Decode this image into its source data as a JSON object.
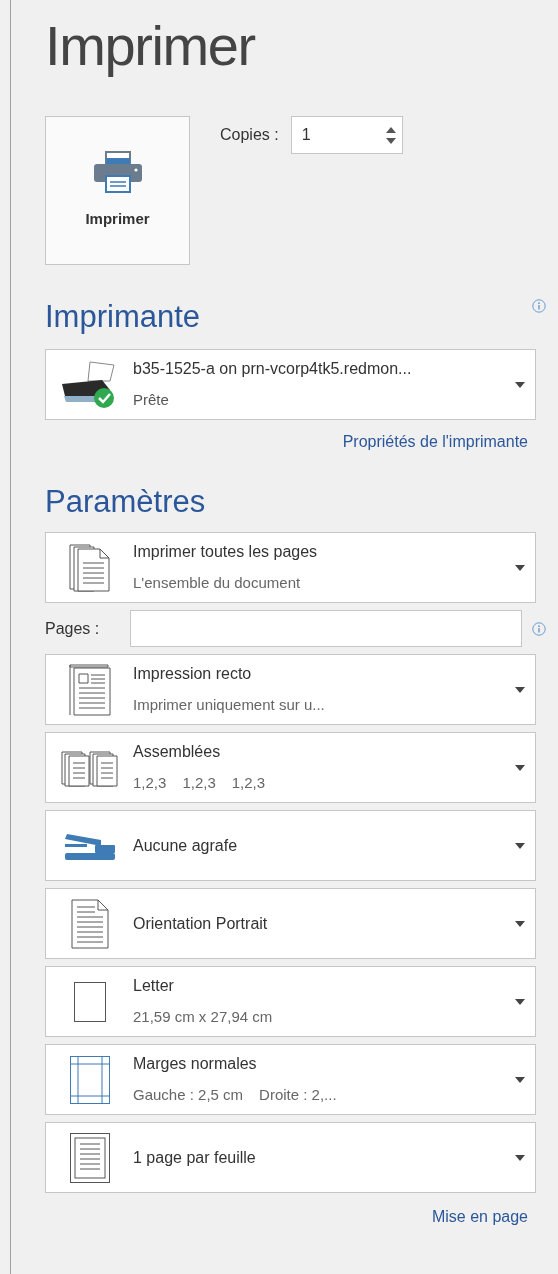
{
  "title": "Imprimer",
  "print_button": {
    "label": "Imprimer"
  },
  "copies": {
    "label": "Copies :",
    "value": "1"
  },
  "printer": {
    "heading": "Imprimante",
    "name": "b35-1525-a on prn-vcorp4tk5.redmon...",
    "status": "Prête",
    "properties_link": "Propriétés de l'imprimante"
  },
  "settings": {
    "heading": "Paramètres",
    "items": [
      {
        "kind": "pages_range",
        "title": "Imprimer toutes les pages",
        "detail": [
          "L'ensemble du document"
        ]
      },
      {
        "kind": "pages",
        "label": "Pages :"
      },
      {
        "kind": "sides",
        "title": "Impression recto",
        "detail": [
          "Imprimer uniquement sur u..."
        ]
      },
      {
        "kind": "collate",
        "title": "Assemblées",
        "detail": [
          "1,2,3",
          "1,2,3",
          "1,2,3"
        ]
      },
      {
        "kind": "staple",
        "title": "Aucune agrafe"
      },
      {
        "kind": "orientation",
        "title": "Orientation Portrait"
      },
      {
        "kind": "paper",
        "title": "Letter",
        "detail": [
          "21,59 cm x 27,94 cm"
        ]
      },
      {
        "kind": "margins",
        "title": "Marges normales",
        "detail": [
          "Gauche : 2,5 cm",
          "Droite : 2,..."
        ]
      },
      {
        "kind": "per_sheet",
        "title": "1 page par feuille"
      }
    ],
    "page_setup_link": "Mise en page"
  }
}
